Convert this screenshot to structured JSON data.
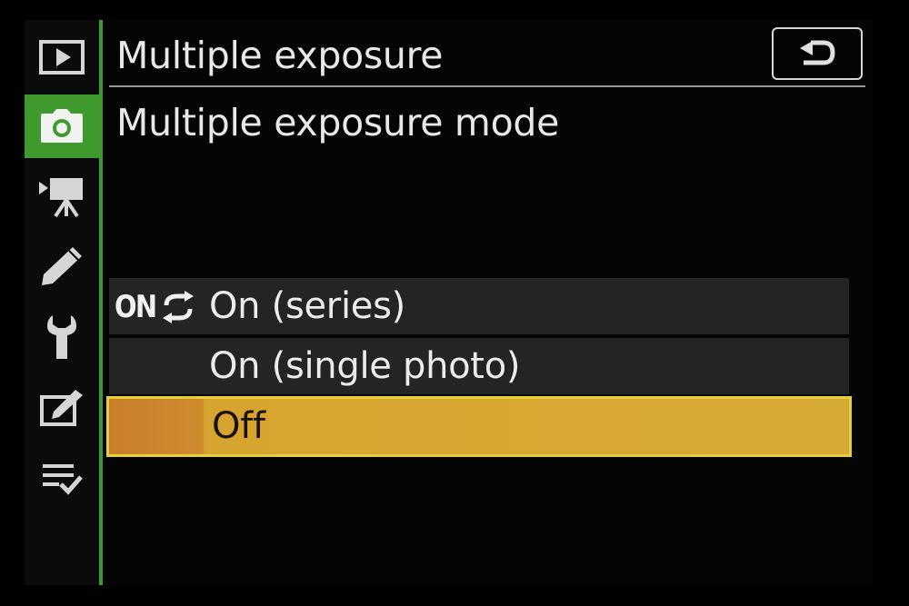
{
  "header": {
    "title": "Multiple exposure",
    "subtitle": "Multiple exposure mode"
  },
  "sidebar": {
    "items": [
      {
        "icon": "playback-icon",
        "active": false
      },
      {
        "icon": "camera-icon",
        "active": true
      },
      {
        "icon": "movie-camera-icon",
        "active": false
      },
      {
        "icon": "pencil-icon",
        "active": false
      },
      {
        "icon": "wrench-icon",
        "active": false
      },
      {
        "icon": "retouch-icon",
        "active": false
      },
      {
        "icon": "my-menu-icon",
        "active": false
      }
    ]
  },
  "options": [
    {
      "badge": "ON",
      "badge_icon": "series-cycle-icon",
      "label": "On (series)",
      "selected": false
    },
    {
      "badge": "",
      "label": "On (single photo)",
      "selected": false
    },
    {
      "badge": "",
      "label": "Off",
      "selected": true
    }
  ],
  "colors": {
    "accent_green": "#3f9a2e",
    "selection_yellow": "#d6ab35",
    "selection_border": "#e7cf3c",
    "row_background": "#242424"
  }
}
